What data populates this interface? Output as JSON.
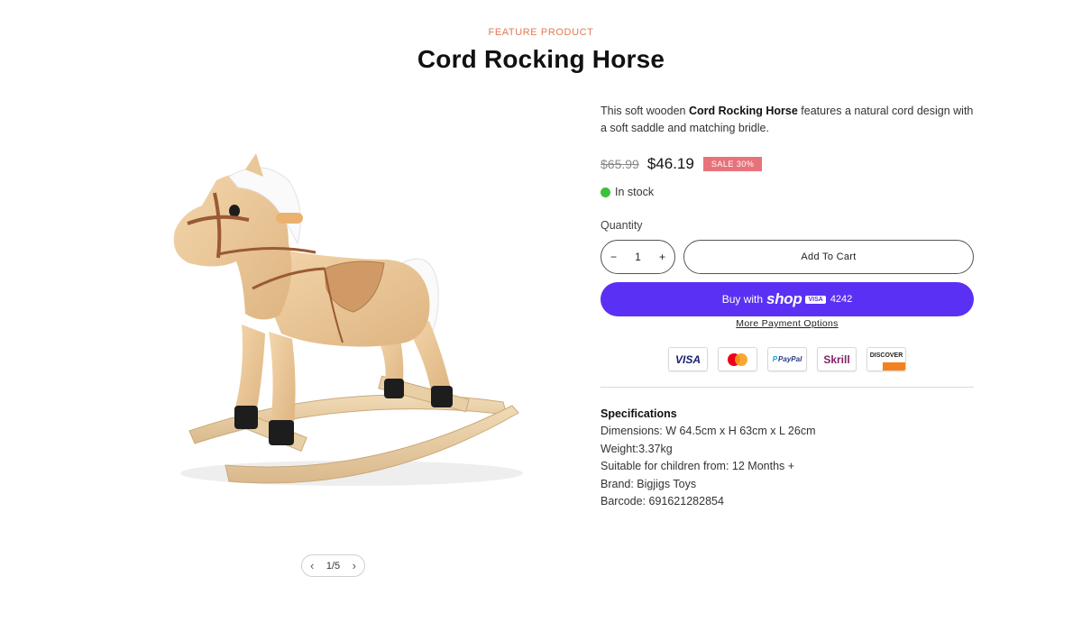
{
  "header": {
    "eyebrow": "FEATURE PRODUCT",
    "title": "Cord Rocking Horse"
  },
  "product": {
    "description_prefix": "This soft wooden ",
    "description_name": "Cord Rocking Horse",
    "description_suffix": " features a natural cord design with a soft saddle and matching bridle.",
    "old_price": "$65.99",
    "price": "$46.19",
    "sale_badge": "SALE 30%",
    "stock_status": "In stock",
    "quantity_label": "Quantity",
    "quantity_value": "1",
    "add_to_cart_label": "Add To Cart",
    "shop_pay": {
      "prefix": "Buy with",
      "brand": "shop",
      "card_brand": "VISA",
      "card_last4": "4242"
    },
    "more_payment_label": "More Payment Options"
  },
  "payment_icons": [
    {
      "icon": "visa-icon",
      "label": "VISA"
    },
    {
      "icon": "mastercard-icon",
      "label": ""
    },
    {
      "icon": "paypal-icon",
      "label": "PayPal"
    },
    {
      "icon": "skrill-icon",
      "label": "Skrill"
    },
    {
      "icon": "discover-icon",
      "label": "DISCOVER"
    }
  ],
  "gallery": {
    "pager_text": "1/5"
  },
  "specs": {
    "title": "Specifications",
    "lines": [
      "Dimensions: W 64.5cm x H 63cm x L 26cm",
      "Weight:3.37kg",
      "Suitable for children from: 12 Months +",
      "Brand: Bigjigs Toys",
      "Barcode: 691621282854"
    ]
  },
  "colors": {
    "accent": "#5a31f4",
    "eyebrow": "#e07a53",
    "sale": "#e7737a",
    "in_stock": "#3cc13c"
  }
}
